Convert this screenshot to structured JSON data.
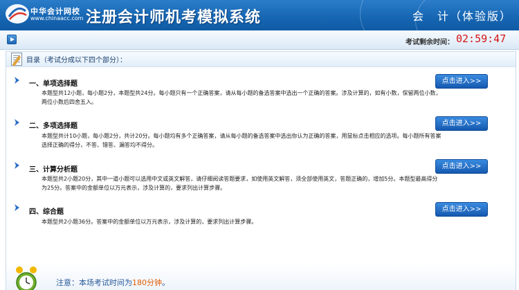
{
  "header": {
    "brand_name": "中华会计网校",
    "brand_url": "www.chinaacc.com",
    "system_title": "注册会计师机考模拟系统",
    "subject": "会　计（体验版）"
  },
  "timer": {
    "label": "考试剩余时间：",
    "value": "02:59:47"
  },
  "toc": {
    "title": "目录（考试分成以下四个部分）："
  },
  "sections": [
    {
      "title": "一、单项选择题",
      "desc": "本题型共12小题，每小题2分，本题型共24分。每小题只有一个正确答案，请从每小题的备选答案中选出一个正确的答案。涉及计算的，如有小数，保留两位小数，两位小数后四舍五入。",
      "button": "点击进入>>"
    },
    {
      "title": "二、多项选择题",
      "desc": "本题型共计10小题，每小题2分，共计20分。每小题均有多个正确答案，请从每小题的备选答案中选出你认为正确的答案，用鼠标点击相应的选项。每小题所有答案选择正确的得分，不答、错答、漏答均不得分。",
      "button": "点击进入>>"
    },
    {
      "title": "三、计算分析题",
      "desc": "本题型共2小题20分，其中一道小题可以选用中文或英文解答，请仔细阅读答题要求，如使用英文解答，须全部使用英文，答题正确的，增加5分。本题型最高得分为25分。答案中的金额单位以万元表示，涉及计算的，要求列出计算步骤。",
      "button": "点击进入>>"
    },
    {
      "title": "四、综合题",
      "desc": "本题型共2小题36分。答案中的金额单位以万元表示，涉及计算的，要求列出计算步骤。",
      "button": "点击进入>>"
    }
  ],
  "notice": {
    "prefix": "注意：本场考试时间为",
    "highlight": "180分钟",
    "suffix": "。"
  }
}
